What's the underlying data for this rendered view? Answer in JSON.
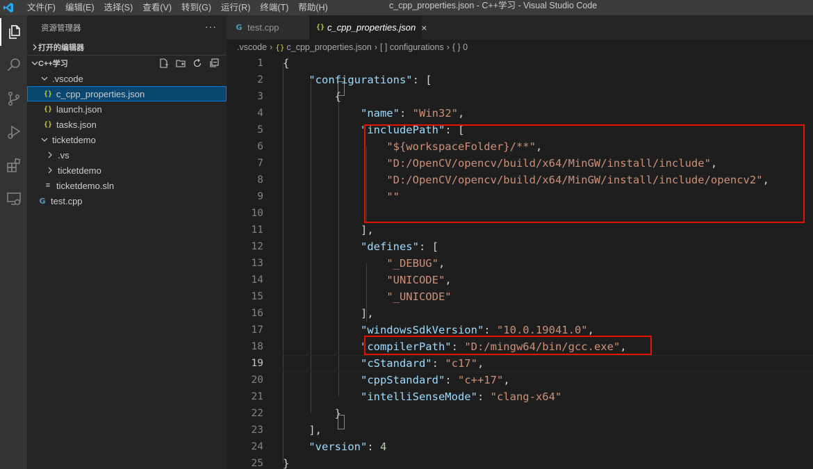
{
  "window": {
    "title": "c_cpp_properties.json - C++学习 - Visual Studio Code",
    "menu": [
      "文件(F)",
      "编辑(E)",
      "选择(S)",
      "查看(V)",
      "转到(G)",
      "运行(R)",
      "终端(T)",
      "帮助(H)"
    ]
  },
  "activity_bar": {
    "icons": [
      "explorer-icon",
      "search-icon",
      "source-control-icon",
      "run-debug-icon",
      "extensions-icon",
      "remote-explorer-icon"
    ]
  },
  "sidebar": {
    "header": "资源管理器",
    "more": "···",
    "open_editors": "打开的编辑器",
    "workspace": "C++学习",
    "tree": [
      {
        "label": ".vscode",
        "type": "folder",
        "expanded": true
      },
      {
        "label": "c_cpp_properties.json",
        "type": "json",
        "selected": true
      },
      {
        "label": "launch.json",
        "type": "json"
      },
      {
        "label": "tasks.json",
        "type": "json"
      },
      {
        "label": "ticketdemo",
        "type": "folder",
        "expanded": true
      },
      {
        "label": ".vs",
        "type": "folder",
        "expanded": false
      },
      {
        "label": "ticketdemo",
        "type": "folder",
        "expanded": false
      },
      {
        "label": "ticketdemo.sln",
        "type": "sln"
      },
      {
        "label": "test.cpp",
        "type": "cpp"
      }
    ]
  },
  "editor": {
    "tabs": [
      {
        "label": "test.cpp",
        "active": false
      },
      {
        "label": "c_cpp_properties.json",
        "active": true
      }
    ],
    "json_icon": "{}",
    "cpp_icon": "G",
    "sln_icon": "≡",
    "close_glyph": "×",
    "breadcrumb": [
      ".vscode",
      "c_cpp_properties.json",
      "[ ] configurations",
      "{ } 0"
    ],
    "current_line": 19,
    "code": {
      "l1": "{",
      "l2_key": "\"configurations\"",
      "l2_rest": ": [",
      "l3": "{",
      "l4_key": "\"name\"",
      "l4_sep": ": ",
      "l4_val": "\"Win32\"",
      "l4_end": ",",
      "l5_key": "\"includePath\"",
      "l5_rest": ": [",
      "l6_val": "\"${workspaceFolder}/**\"",
      "l6_end": ",",
      "l7_val": "\"D:/OpenCV/opencv/build/x64/MinGW/install/include\"",
      "l7_end": ",",
      "l8_val": "\"D:/OpenCV/opencv/build/x64/MinGW/install/include/opencv2\"",
      "l8_end": ",",
      "l9_val": "\"\"",
      "l11": "],",
      "l12_key": "\"defines\"",
      "l12_rest": ": [",
      "l13_val": "\"_DEBUG\"",
      "l13_end": ",",
      "l14_val": "\"UNICODE\"",
      "l14_end": ",",
      "l15_val": "\"_UNICODE\"",
      "l16": "],",
      "l17_key": "\"windowsSdkVersion\"",
      "l17_sep": ": ",
      "l17_val": "\"10.0.19041.0\"",
      "l17_end": ",",
      "l18_key": "\"compilerPath\"",
      "l18_sep": ": ",
      "l18_val": "\"D:/mingw64/bin/gcc.exe\"",
      "l18_end": ",",
      "l19_key": "\"cStandard\"",
      "l19_sep": ": ",
      "l19_val": "\"c17\"",
      "l19_end": ",",
      "l20_key": "\"cppStandard\"",
      "l20_sep": ": ",
      "l20_val": "\"c++17\"",
      "l20_end": ",",
      "l21_key": "\"intelliSenseMode\"",
      "l21_sep": ": ",
      "l21_val": "\"clang-x64\"",
      "l22": "}",
      "l23": "],",
      "l24_key": "\"version\"",
      "l24_sep": ": ",
      "l24_val": "4",
      "l25": "}"
    },
    "line_numbers": [
      "1",
      "2",
      "3",
      "4",
      "5",
      "6",
      "7",
      "8",
      "9",
      "10",
      "11",
      "12",
      "13",
      "14",
      "15",
      "16",
      "17",
      "18",
      "19",
      "20",
      "21",
      "22",
      "23",
      "24",
      "25"
    ]
  },
  "colors": {
    "accent_selection": "#094771",
    "highlight_box": "#e51400",
    "json_key": "#9cdcfe",
    "json_string": "#ce9178",
    "json_number": "#b5cea8"
  }
}
